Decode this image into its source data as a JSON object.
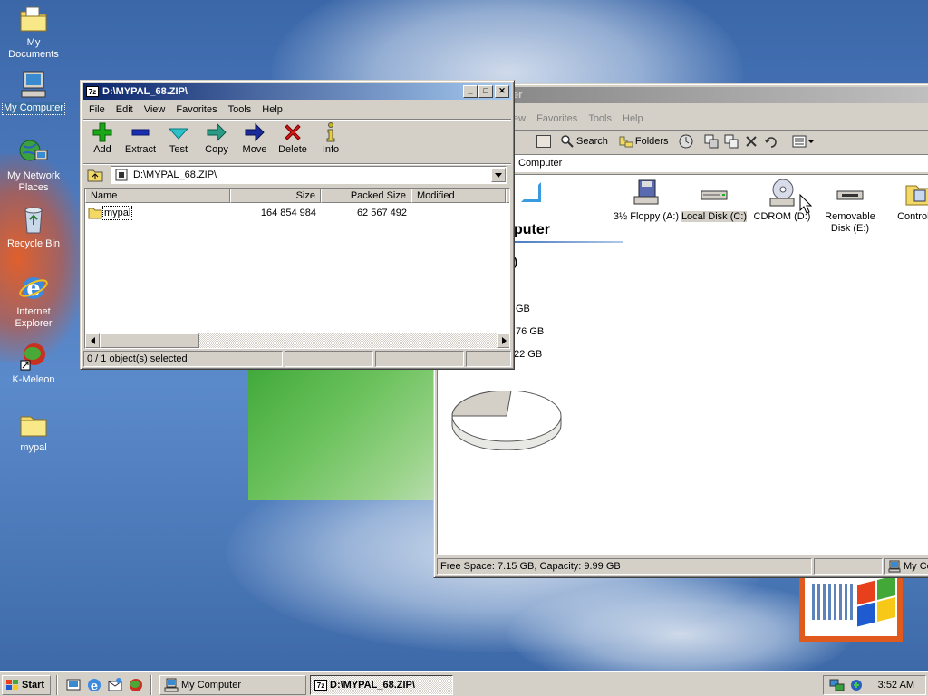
{
  "desktop": {
    "icons": [
      {
        "label": "My Documents"
      },
      {
        "label": "My Computer"
      },
      {
        "label": "My Network Places"
      },
      {
        "label": "Recycle Bin"
      },
      {
        "label": "Internet Explorer"
      },
      {
        "label": "K-Meleon"
      },
      {
        "label": "mypal"
      }
    ]
  },
  "explorer": {
    "title_fragment": "er",
    "menu": [
      "ew",
      "Favorites",
      "Tools",
      "Help"
    ],
    "toolbar": {
      "search": "Search",
      "folders": "Folders"
    },
    "address_value": "Computer",
    "heading": "puter",
    "info_lines": [
      ":)",
      "GB",
      ".76 GB",
      "22 GB"
    ],
    "drives": [
      {
        "label": "3½ Floppy (A:)"
      },
      {
        "label": "Local Disk (C:)"
      },
      {
        "label": "CDROM (D:)"
      },
      {
        "label": "Removable Disk (E:)"
      },
      {
        "label": "Control P"
      }
    ],
    "status_text": "Free Space: 7.15 GB, Capacity: 9.99 GB",
    "status_zone": "My Co"
  },
  "zip_window": {
    "title": "D:\\MYPAL_68.ZIP\\",
    "title_icon_text": "7z",
    "menu": [
      "File",
      "Edit",
      "View",
      "Favorites",
      "Tools",
      "Help"
    ],
    "toolbar": [
      {
        "label": "Add",
        "icon": "plus-icon",
        "color": "#1aa818"
      },
      {
        "label": "Extract",
        "icon": "minus-icon",
        "color": "#1a2fb0"
      },
      {
        "label": "Test",
        "icon": "check-arrow-icon",
        "color": "#2cc0c8"
      },
      {
        "label": "Copy",
        "icon": "arrow-right-icon",
        "color": "#2b9b86"
      },
      {
        "label": "Move",
        "icon": "arrow-right-icon",
        "color": "#1a2a9a"
      },
      {
        "label": "Delete",
        "icon": "x-icon",
        "color": "#d81818"
      },
      {
        "label": "Info",
        "icon": "info-icon",
        "color": "#c8b020"
      }
    ],
    "address_value": "D:\\MYPAL_68.ZIP\\",
    "columns": [
      "Name",
      "Size",
      "Packed Size",
      "Modified"
    ],
    "rows": [
      {
        "name": "mypal",
        "size": "164 854 984",
        "packed": "62 567 492",
        "modified": ""
      }
    ],
    "status_text": "0 / 1 object(s) selected"
  },
  "taskbar": {
    "start_label": "Start",
    "tasks": [
      {
        "label": "My Computer"
      },
      {
        "label": "D:\\MYPAL_68.ZIP\\",
        "icon_text": "7z"
      }
    ],
    "clock": "3:52 AM"
  },
  "colors": {
    "selection": "#0a246a",
    "title_active": "#0a246a",
    "face": "#d4d0c8"
  }
}
